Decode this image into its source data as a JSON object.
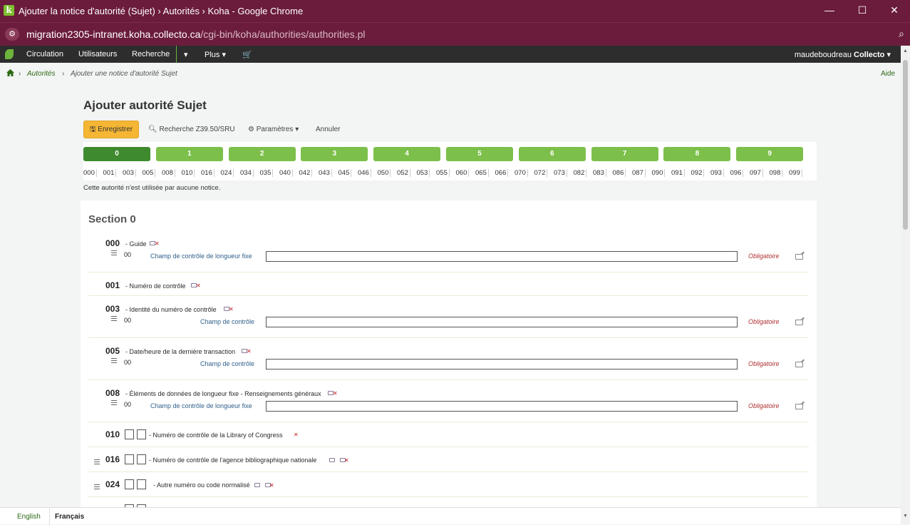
{
  "browser": {
    "title": "Ajouter la notice d'autorité (Sujet) › Autorités › Koha - Google Chrome",
    "url_host": "migration2305-intranet.koha.collecto.ca",
    "url_path": "/cgi-bin/koha/authorities/authorities.pl",
    "icon": "k",
    "minimize": "—",
    "maximize": "☐",
    "close": "✕"
  },
  "nav": {
    "items": [
      "Circulation",
      "Utilisateurs",
      "Recherche"
    ],
    "more": "Plus ▾",
    "cart": "🛒",
    "caret": "▾",
    "user": "maudeboudreau",
    "library": "Collecto"
  },
  "breadcrumb": {
    "link": "Autorités",
    "current": "Ajouter une notice d'autorité Sujet",
    "help": "Aide"
  },
  "page": {
    "title": "Ajouter autorité Sujet",
    "usage": "Cette autorité n'est utilisée par aucune notice."
  },
  "toolbar": {
    "save": "Enregistrer",
    "z3950": "Recherche Z39.50/SRU",
    "settings": "Paramètres ▾",
    "cancel": "Annuler"
  },
  "tabs": [
    "0",
    "1",
    "2",
    "3",
    "4",
    "5",
    "6",
    "7",
    "8",
    "9"
  ],
  "field_links": [
    "000",
    "001",
    "003",
    "005",
    "008",
    "010",
    "016",
    "024",
    "034",
    "035",
    "040",
    "042",
    "043",
    "045",
    "046",
    "050",
    "052",
    "053",
    "055",
    "060",
    "065",
    "066",
    "070",
    "072",
    "073",
    "082",
    "083",
    "086",
    "087",
    "090",
    "091",
    "092",
    "093",
    "096",
    "097",
    "098",
    "099"
  ],
  "section": {
    "title": "Section 0"
  },
  "fields": [
    {
      "tag": "000",
      "desc": "- Guide",
      "code": "00",
      "label": "Champ de contrôle de longueur fixe",
      "mandatory": "Obligatoire"
    },
    {
      "tag": "001",
      "desc": "- Numéro de contrôle"
    },
    {
      "tag": "003",
      "desc": "- Identité du numéro de contrôle",
      "code": "00",
      "label": "Champ de contrôle",
      "mandatory": "Obligatoire"
    },
    {
      "tag": "005",
      "desc": "- Date/heure de la dernière transaction",
      "code": "00",
      "label": "Champ de contrôle",
      "mandatory": "Obligatoire"
    },
    {
      "tag": "008",
      "desc": "- Éléments de données de longueur fixe - Renseignements généraux",
      "code": "00",
      "label": "Champ de contrôle de longueur fixe",
      "mandatory": "Obligatoire"
    },
    {
      "tag": "010",
      "desc": "- Numéro de contrôle de la Library of Congress"
    },
    {
      "tag": "016",
      "desc": "- Numéro de contrôle de l'agence bibliographique nationale"
    },
    {
      "tag": "024",
      "desc": "- Autre numéro ou code normalisé"
    }
  ],
  "languages": [
    "English",
    "Français"
  ],
  "colors": {
    "chrome": "#6b1c3c",
    "tab": "#7cbf4a",
    "tab_active": "#3e8a2e",
    "save": "#f5b634",
    "mandatory": "#b03030"
  }
}
